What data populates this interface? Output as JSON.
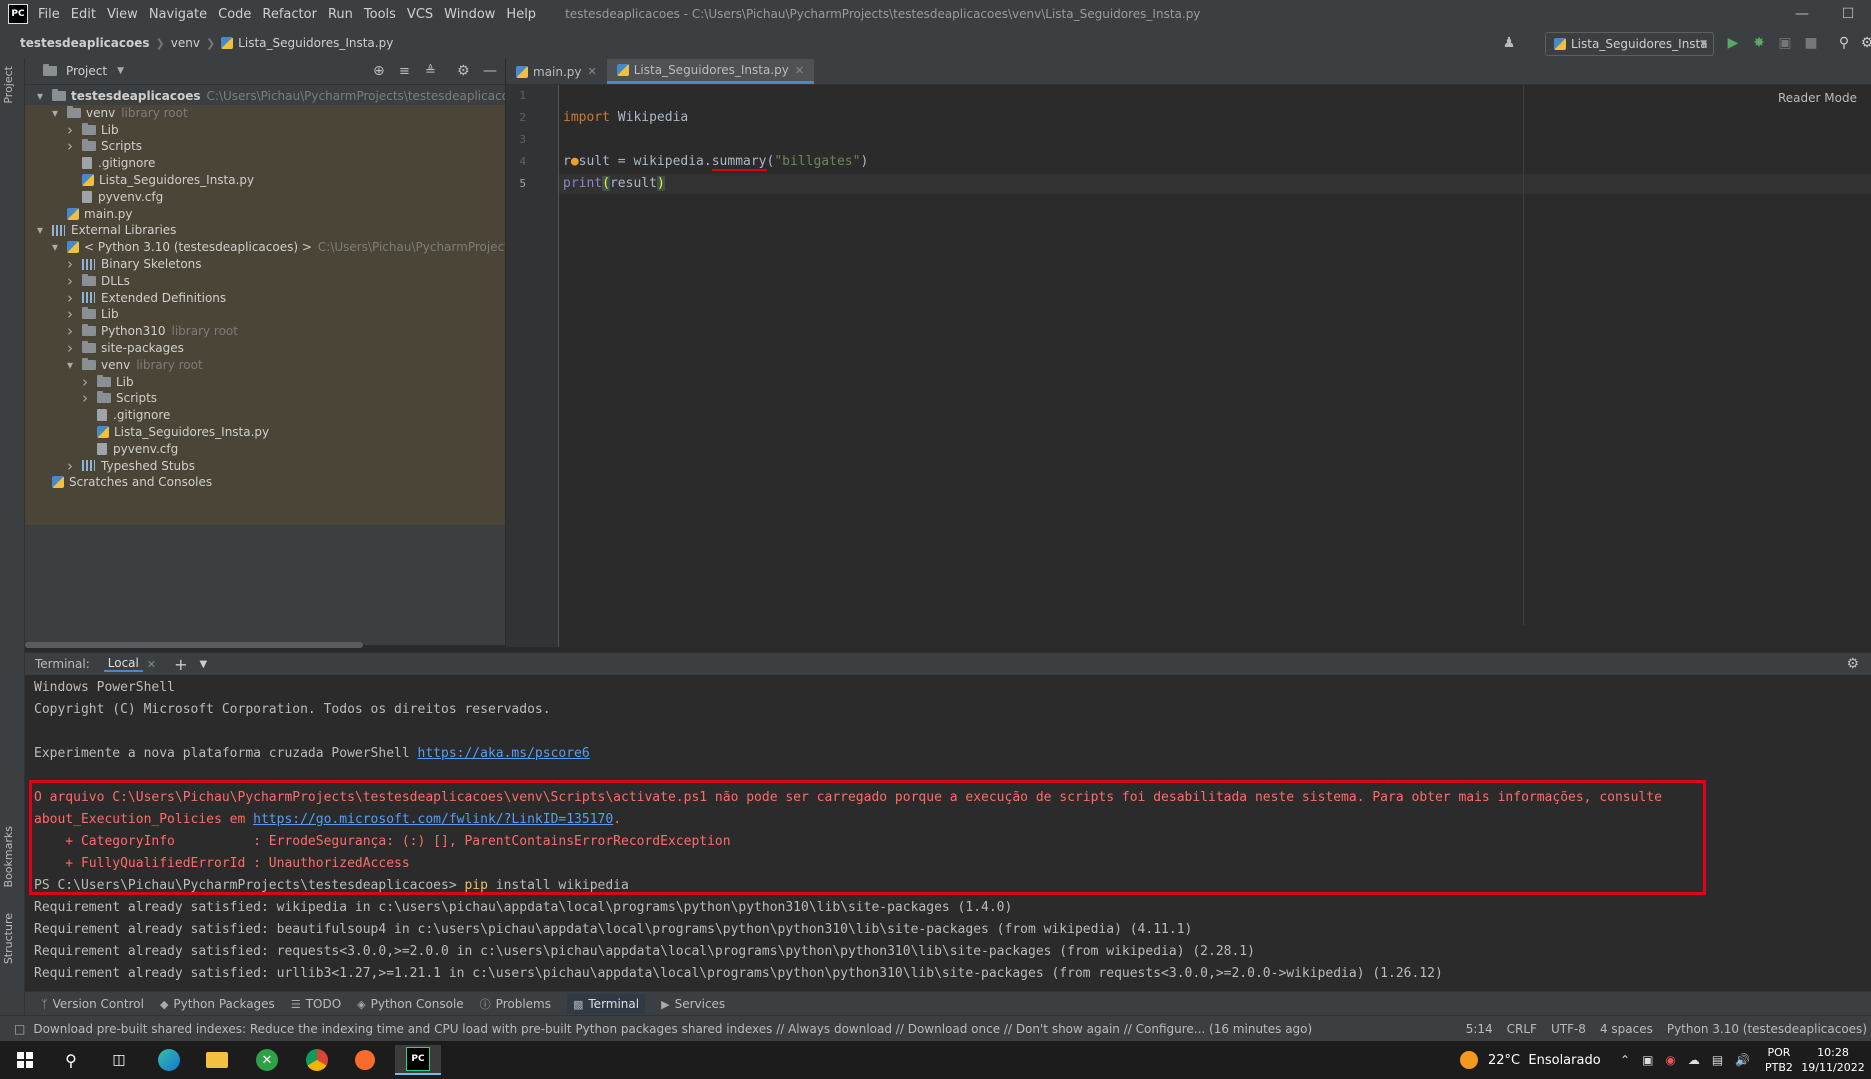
{
  "window": {
    "menu": [
      "File",
      "Edit",
      "View",
      "Navigate",
      "Code",
      "Refactor",
      "Run",
      "Tools",
      "VCS",
      "Window",
      "Help"
    ],
    "title": "testesdeaplicacoes - C:\\Users\\Pichau\\PycharmProjects\\testesdeaplicacoes\\venv\\Lista_Seguidores_Insta.py"
  },
  "breadcrumb": [
    "testesdeaplicacoes",
    "venv",
    "Lista_Seguidores_Insta.py"
  ],
  "run_config": "Lista_Seguidores_Insta",
  "project_panel": {
    "header": "Project",
    "tree": [
      {
        "label": "testesdeaplicacoes",
        "hint": "C:\\Users\\Pichau\\PycharmProjects\\testesdeaplicacoes",
        "icon": "folder",
        "chev": "down",
        "bold": true
      },
      {
        "label": "venv",
        "hint": "library root",
        "icon": "folder",
        "chev": "down"
      },
      {
        "label": "Lib",
        "hint": "",
        "icon": "folder",
        "chev": "right"
      },
      {
        "label": "Scripts",
        "hint": "",
        "icon": "folder",
        "chev": "right"
      },
      {
        "label": ".gitignore",
        "hint": "",
        "icon": "txt",
        "chev": "none"
      },
      {
        "label": "Lista_Seguidores_Insta.py",
        "hint": "",
        "icon": "py",
        "chev": "none"
      },
      {
        "label": "pyvenv.cfg",
        "hint": "",
        "icon": "txt",
        "chev": "none"
      },
      {
        "label": "main.py",
        "hint": "",
        "icon": "py",
        "chev": "none"
      },
      {
        "label": "External Libraries",
        "hint": "",
        "icon": "lib",
        "chev": "down"
      },
      {
        "label": "< Python 3.10 (testesdeaplicacoes) >",
        "hint": "C:\\Users\\Pichau\\PycharmProjects\\testes",
        "icon": "py",
        "chev": "down"
      },
      {
        "label": "Binary Skeletons",
        "hint": "",
        "icon": "lib",
        "chev": "right"
      },
      {
        "label": "DLLs",
        "hint": "",
        "icon": "folder",
        "chev": "right"
      },
      {
        "label": "Extended Definitions",
        "hint": "",
        "icon": "lib",
        "chev": "right"
      },
      {
        "label": "Lib",
        "hint": "",
        "icon": "folder",
        "chev": "right"
      },
      {
        "label": "Python310",
        "hint": "library root",
        "icon": "folder",
        "chev": "right"
      },
      {
        "label": "site-packages",
        "hint": "",
        "icon": "folder",
        "chev": "right"
      },
      {
        "label": "venv",
        "hint": "library root",
        "icon": "folder",
        "chev": "down"
      },
      {
        "label": "Lib",
        "hint": "",
        "icon": "folder",
        "chev": "right"
      },
      {
        "label": "Scripts",
        "hint": "",
        "icon": "folder",
        "chev": "right"
      },
      {
        "label": ".gitignore",
        "hint": "",
        "icon": "txt",
        "chev": "none"
      },
      {
        "label": "Lista_Seguidores_Insta.py",
        "hint": "",
        "icon": "py",
        "chev": "none"
      },
      {
        "label": "pyvenv.cfg",
        "hint": "",
        "icon": "txt",
        "chev": "none"
      },
      {
        "label": "Typeshed Stubs",
        "hint": "",
        "icon": "lib",
        "chev": "right"
      },
      {
        "label": "Scratches and Consoles",
        "hint": "",
        "icon": "scratch",
        "chev": "none"
      }
    ]
  },
  "editor": {
    "tabs": [
      {
        "label": "main.py",
        "active": false
      },
      {
        "label": "Lista_Seguidores_Insta.py",
        "active": true
      }
    ],
    "line_numbers": [
      "1",
      "2",
      "3",
      "4",
      "5"
    ],
    "reader_mode": "Reader Mode"
  },
  "terminal": {
    "label": "Terminal:",
    "tab": "Local",
    "lines": {
      "l1": "Windows PowerShell",
      "l2": "Copyright (C) Microsoft Corporation. Todos os direitos reservados.",
      "l3_prefix": "Experimente a nova plataforma cruzada PowerShell ",
      "l3_link": "https://aka.ms/pscore6",
      "err1": "O arquivo C:\\Users\\Pichau\\PycharmProjects\\testesdeaplicacoes\\venv\\Scripts\\activate.ps1 não pode ser carregado porque a execução de scripts foi desabilitada neste sistema. Para obter mais informações, consulte",
      "err2_prefix": "about_Execution_Policies em ",
      "err2_link": "https://go.microsoft.com/fwlink/?LinkID=135170",
      "err2_suffix": ".",
      "err3": "    + CategoryInfo          : ErrodeSegurança: (:) [], ParentContainsErrorRecordException",
      "err4": "    + FullyQualifiedErrorId : UnauthorizedAccess",
      "prompt": "PS C:\\Users\\Pichau\\PycharmProjects\\testesdeaplicacoes> ",
      "cmd_pip": "pip",
      "cmd_rest": " install wikipedia",
      "r1": "Requirement already satisfied: wikipedia in c:\\users\\pichau\\appdata\\local\\programs\\python\\python310\\lib\\site-packages (1.4.0)",
      "r2": "Requirement already satisfied: beautifulsoup4 in c:\\users\\pichau\\appdata\\local\\programs\\python\\python310\\lib\\site-packages (from wikipedia) (4.11.1)",
      "r3": "Requirement already satisfied: requests<3.0.0,>=2.0.0 in c:\\users\\pichau\\appdata\\local\\programs\\python\\python310\\lib\\site-packages (from wikipedia) (2.28.1)",
      "r4": "Requirement already satisfied: urllib3<1.27,>=1.21.1 in c:\\users\\pichau\\appdata\\local\\programs\\python\\python310\\lib\\site-packages (from requests<3.0.0,>=2.0.0->wikipedia) (1.26.12)"
    }
  },
  "tool_tabs": [
    "Version Control",
    "Python Packages",
    "TODO",
    "Python Console",
    "Problems",
    "Terminal",
    "Services"
  ],
  "status": {
    "message": "Download pre-built shared indexes: Reduce the indexing time and CPU load with pre-built Python packages shared indexes // Always download // Download once // Don't show again // Configure... (16 minutes ago)",
    "position": "5:14",
    "line_sep": "CRLF",
    "encoding": "UTF-8",
    "indent": "4 spaces",
    "interpreter": "Python 3.10 (testesdeaplicacoes)"
  },
  "taskbar": {
    "weather": "22°C  Ensolarado",
    "lang1": "POR",
    "lang2": "PTB2",
    "time": "10:28",
    "date": "19/11/2022"
  },
  "side_tabs": {
    "project": "Project",
    "bookmarks": "Bookmarks",
    "structure": "Structure"
  }
}
